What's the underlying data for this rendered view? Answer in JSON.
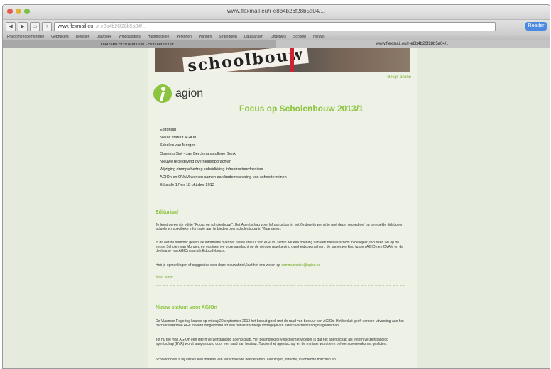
{
  "browser": {
    "window_title": "www.flexmail.eu/r-e8b4b26f28b5a04/...",
    "url": "www.flexmail.eu",
    "url_rest": "/r-e8b4b26f28b5a04/...",
    "reader_label": "Reader",
    "bookmarks": [
      "Pratoomenggemeenten",
      "Gebruikers",
      "Diensten",
      "Jaarboek",
      "Windowsdocs",
      "Hulpmiddelen",
      "Personen",
      "Plannen",
      "Strategieen",
      "Databanken",
      "Onderwijs",
      "Scholen",
      "Nieuws"
    ],
    "tabs": [
      {
        "label": "Diensten Scholenbouw - Scholenbouw ..."
      },
      {
        "label": "www.flexmail.eu/r-e8b4b26f28b5a04/..."
      }
    ]
  },
  "newsletter": {
    "online_link": "Bekijk online",
    "logo_text": "agion",
    "title": "Focus op Scholenbouw  2013/1",
    "toc": [
      "Editoriaal",
      "Nieuw statuut AGIOn",
      "Scholen van Morgen",
      "Opening Sint - Jan Berchmanscollege Genk",
      "Nieuwe regelgeving overheidsopdrachten",
      "Wijziging drempelbedrag subsidiëring infrastructuurdossiers",
      "AGIOn en OVAM werken samen aan bodemsanering van schoolterreinen",
      "Educafe 17 en 18 oktober 2013"
    ],
    "sections": [
      {
        "heading": "Editoriaal",
        "paragraphs": [
          "Je leest de eerste editie \"Focus op scholenbouw\". Het Agentschap voor Infrastructuur in het Onderwijs wenst je met deze nieuwsbrief op geregelde tijdstippen actuele en specifieke informatie aan te bieden over scholenbouw in Vlaanderen.",
          "In dit eerste nummer geven we informatie over het nieuw statuut van AGIOn, zetten we een opening van een nieuwe school in de kijker, focussen we op de eerste Scholen van Morgen, en vestigen we onze aandacht op de nieuwe regelgeving overheidsopdrachten, de samenwerking tussen AGIOn en OVAM en de deelname van AGIOn aan de Educafebeurs.",
          "Heb je opmerkingen of suggesties over deze nieuwsbrief, laat het ons weten op"
        ],
        "email": "communicatie@agion.be",
        "more": "Meer lezen"
      },
      {
        "heading": "Nieuw statuut voor AGIOn",
        "paragraphs": [
          "De Vlaamse Regering keurde op vrijdag 20 september 2013 het besluit goed met de raad van bestuur van AGIOn. Het besluit geeft verdere uitvoering aan het decreet waarmee AGIOn werd omgevormd tot een publiekrechtelijk vormgegeven extern verzelfstandigd agentschap.",
          "Tot nu toe was AGIOn een intern verzelfstandigd agentschap. Het belangrijkste verschil met vroeger is dat het agentschap als extern verzelfstandigd agentschap (EVA) wordt aangestuurd door een raad van bestuur. Tussen het agentschap en de minister wordt een beheersovereenkomst gesloten.",
          "Scholenbouw is bij uitstek een materie van verschillende betrokkenen. Leerlingen, directie, inrichtende machten en"
        ]
      }
    ]
  },
  "colors": {
    "accent": "#8bc43f",
    "page_bg": "#e6ecdd"
  }
}
